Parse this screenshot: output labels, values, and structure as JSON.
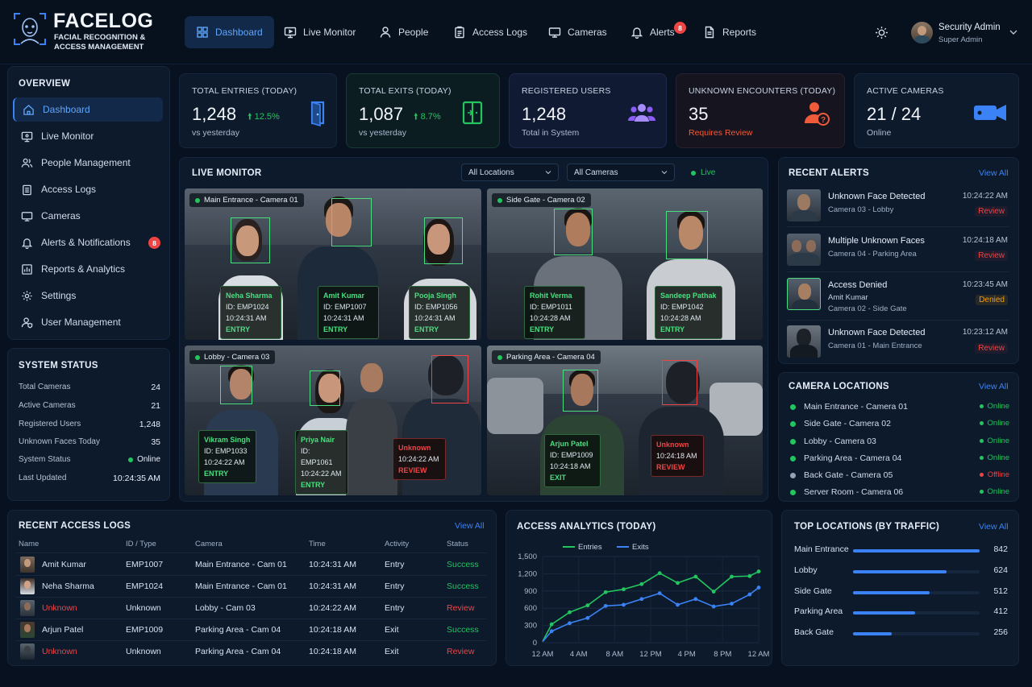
{
  "app": {
    "title": "FACELOG",
    "subtitle": "FACIAL RECOGNITION & ACCESS MANAGEMENT"
  },
  "nav": {
    "items": [
      {
        "label": "Dashboard",
        "icon": "grid-icon"
      },
      {
        "label": "Live Monitor",
        "icon": "monitor-icon"
      },
      {
        "label": "People",
        "icon": "user-icon"
      },
      {
        "label": "Access Logs",
        "icon": "clipboard-icon"
      },
      {
        "label": "Cameras",
        "icon": "camera-icon"
      },
      {
        "label": "Alerts",
        "icon": "bell-icon",
        "badge": "8"
      },
      {
        "label": "Reports",
        "icon": "document-icon"
      }
    ]
  },
  "user": {
    "name": "Security Admin",
    "role": "Super Admin"
  },
  "sidebar": {
    "overview_title": "OVERVIEW",
    "items": [
      {
        "label": "Dashboard"
      },
      {
        "label": "Live Monitor"
      },
      {
        "label": "People Management"
      },
      {
        "label": "Access Logs"
      },
      {
        "label": "Cameras"
      },
      {
        "label": "Alerts & Notifications",
        "badge": "8"
      },
      {
        "label": "Reports & Analytics"
      },
      {
        "label": "Settings"
      },
      {
        "label": "User Management"
      }
    ],
    "system_status": {
      "title": "SYSTEM STATUS",
      "rows": [
        {
          "label": "Total Cameras",
          "value": "24"
        },
        {
          "label": "Active Cameras",
          "value": "21"
        },
        {
          "label": "Registered Users",
          "value": "1,248"
        },
        {
          "label": "Unknown Faces Today",
          "value": "35"
        },
        {
          "label": "System Status",
          "value": "Online"
        },
        {
          "label": "Last Updated",
          "value": "10:24:35 AM"
        }
      ]
    }
  },
  "stats": [
    {
      "label": "TOTAL ENTRIES (TODAY)",
      "value": "1,248",
      "change": "12.5%",
      "sub": "vs yesterday",
      "icon": "door-icon"
    },
    {
      "label": "TOTAL EXITS (TODAY)",
      "value": "1,087",
      "change": "8.7%",
      "sub": "vs yesterday",
      "icon": "exit-door-icon"
    },
    {
      "label": "REGISTERED USERS",
      "value": "1,248",
      "sub": "Total in System",
      "icon": "users-icon"
    },
    {
      "label": "UNKNOWN ENCOUNTERS (TODAY)",
      "value": "35",
      "sub": "Requires Review",
      "icon": "unknown-user-icon"
    },
    {
      "label": "ACTIVE CAMERAS",
      "value": "21 / 24",
      "sub": "Online",
      "icon": "video-camera-icon"
    }
  ],
  "live_monitor": {
    "title": "LIVE MONITOR",
    "locations_select": "All Locations",
    "cameras_select": "All Cameras",
    "live_label": "Live",
    "feeds": [
      {
        "label": "Main Entrance - Camera 01",
        "tags": [
          {
            "name": "Neha Sharma",
            "id": "ID: EMP1024",
            "time": "10:24:31 AM",
            "status": "ENTRY"
          },
          {
            "name": "Amit Kumar",
            "id": "ID: EMP1007",
            "time": "10:24:31 AM",
            "status": "ENTRY"
          },
          {
            "name": "Pooja Singh",
            "id": "ID: EMP1056",
            "time": "10:24:31 AM",
            "status": "ENTRY"
          }
        ]
      },
      {
        "label": "Side Gate - Camera 02",
        "tags": [
          {
            "name": "Rohit Verma",
            "id": "ID: EMP1011",
            "time": "10:24:28 AM",
            "status": "ENTRY"
          },
          {
            "name": "Sandeep Pathak",
            "id": "ID: EMP1042",
            "time": "10:24:28 AM",
            "status": "ENTRY"
          }
        ]
      },
      {
        "label": "Lobby - Camera 03",
        "tags": [
          {
            "name": "Vikram Singh",
            "id": "ID: EMP1033",
            "time": "10:24:22 AM",
            "status": "ENTRY"
          },
          {
            "name": "Priya Nair",
            "id": "ID: EMP1061",
            "time": "10:24:22 AM",
            "status": "ENTRY"
          },
          {
            "name": "Unknown",
            "time": "10:24:22 AM",
            "status": "REVIEW"
          }
        ]
      },
      {
        "label": "Parking Area - Camera 04",
        "tags": [
          {
            "name": "Arjun Patel",
            "id": "ID: EMP1009",
            "time": "10:24:18 AM",
            "status": "EXIT"
          },
          {
            "name": "Unknown",
            "time": "10:24:18 AM",
            "status": "REVIEW"
          }
        ]
      }
    ]
  },
  "recent_alerts": {
    "title": "RECENT ALERTS",
    "view_all": "View All",
    "items": [
      {
        "title": "Unknown Face Detected",
        "lines": [
          "Camera 03 - Lobby"
        ],
        "time": "10:24:22 AM",
        "status": "Review"
      },
      {
        "title": "Multiple Unknown Faces",
        "lines": [
          "Camera 04 - Parking Area"
        ],
        "time": "10:24:18 AM",
        "status": "Review"
      },
      {
        "title": "Access Denied",
        "lines": [
          "Amit Kumar",
          "Camera 02 - Side Gate"
        ],
        "time": "10:23:45 AM",
        "status": "Denied"
      },
      {
        "title": "Unknown Face Detected",
        "lines": [
          "Camera 01 - Main Entrance"
        ],
        "time": "10:23:12 AM",
        "status": "Review"
      }
    ]
  },
  "camera_locations": {
    "title": "CAMERA LOCATIONS",
    "view_all": "View All",
    "items": [
      {
        "name": "Main Entrance - Camera 01",
        "status": "Online"
      },
      {
        "name": "Side Gate - Camera 02",
        "status": "Online"
      },
      {
        "name": "Lobby - Camera 03",
        "status": "Online"
      },
      {
        "name": "Parking Area - Camera 04",
        "status": "Online"
      },
      {
        "name": "Back Gate - Camera 05",
        "status": "Offline"
      },
      {
        "name": "Server Room - Camera 06",
        "status": "Online"
      }
    ]
  },
  "access_logs": {
    "title": "RECENT ACCESS LOGS",
    "view_all": "View All",
    "columns": [
      "Name",
      "ID / Type",
      "Camera",
      "Time",
      "Activity",
      "Status"
    ],
    "rows": [
      {
        "name": "Amit Kumar",
        "id": "EMP1007",
        "camera": "Main Entrance - Cam 01",
        "time": "10:24:31 AM",
        "activity": "Entry",
        "status": "Success"
      },
      {
        "name": "Neha Sharma",
        "id": "EMP1024",
        "camera": "Main Entrance - Cam 01",
        "time": "10:24:31 AM",
        "activity": "Entry",
        "status": "Success"
      },
      {
        "name": "Unknown",
        "id": "Unknown",
        "camera": "Lobby - Cam 03",
        "time": "10:24:22 AM",
        "activity": "Entry",
        "status": "Review"
      },
      {
        "name": "Arjun Patel",
        "id": "EMP1009",
        "camera": "Parking Area - Cam 04",
        "time": "10:24:18 AM",
        "activity": "Exit",
        "status": "Success"
      },
      {
        "name": "Unknown",
        "id": "Unknown",
        "camera": "Parking Area - Cam 04",
        "time": "10:24:18 AM",
        "activity": "Exit",
        "status": "Review"
      }
    ]
  },
  "chart_data": {
    "type": "line",
    "title": "ACCESS ANALYTICS (TODAY)",
    "x_ticks": [
      "12 AM",
      "4 AM",
      "8 AM",
      "12 PM",
      "4 PM",
      "8 PM",
      "12 AM"
    ],
    "y_ticks": [
      "0",
      "300",
      "600",
      "900",
      "1,200",
      "1,500"
    ],
    "ylim": [
      0,
      1500
    ],
    "xlim": [
      0,
      24
    ],
    "legend_position": "top",
    "grid": true,
    "series": [
      {
        "name": "Entries",
        "color": "#22c55e",
        "x": [
          0,
          1,
          3,
          5,
          7,
          9,
          11,
          13,
          15,
          17,
          19,
          21,
          23,
          24
        ],
        "y": [
          20,
          320,
          530,
          650,
          880,
          930,
          1020,
          1210,
          1040,
          1150,
          890,
          1150,
          1160,
          1240
        ]
      },
      {
        "name": "Exits",
        "color": "#3b82f6",
        "x": [
          0,
          1,
          3,
          5,
          7,
          9,
          11,
          13,
          15,
          17,
          19,
          21,
          23,
          24
        ],
        "y": [
          20,
          200,
          340,
          430,
          640,
          660,
          760,
          860,
          660,
          760,
          630,
          680,
          840,
          960
        ]
      }
    ]
  },
  "top_locations": {
    "title": "TOP LOCATIONS (BY TRAFFIC)",
    "view_all": "View All",
    "max": 842,
    "items": [
      {
        "name": "Main Entrance",
        "value": 842
      },
      {
        "name": "Lobby",
        "value": 624
      },
      {
        "name": "Side Gate",
        "value": 512
      },
      {
        "name": "Parking Area",
        "value": 412
      },
      {
        "name": "Back Gate",
        "value": 256
      }
    ]
  },
  "colors": {
    "accent": "#3b82f6",
    "success": "#22c55e",
    "danger": "#ef4444",
    "warning": "#f59e0b"
  }
}
